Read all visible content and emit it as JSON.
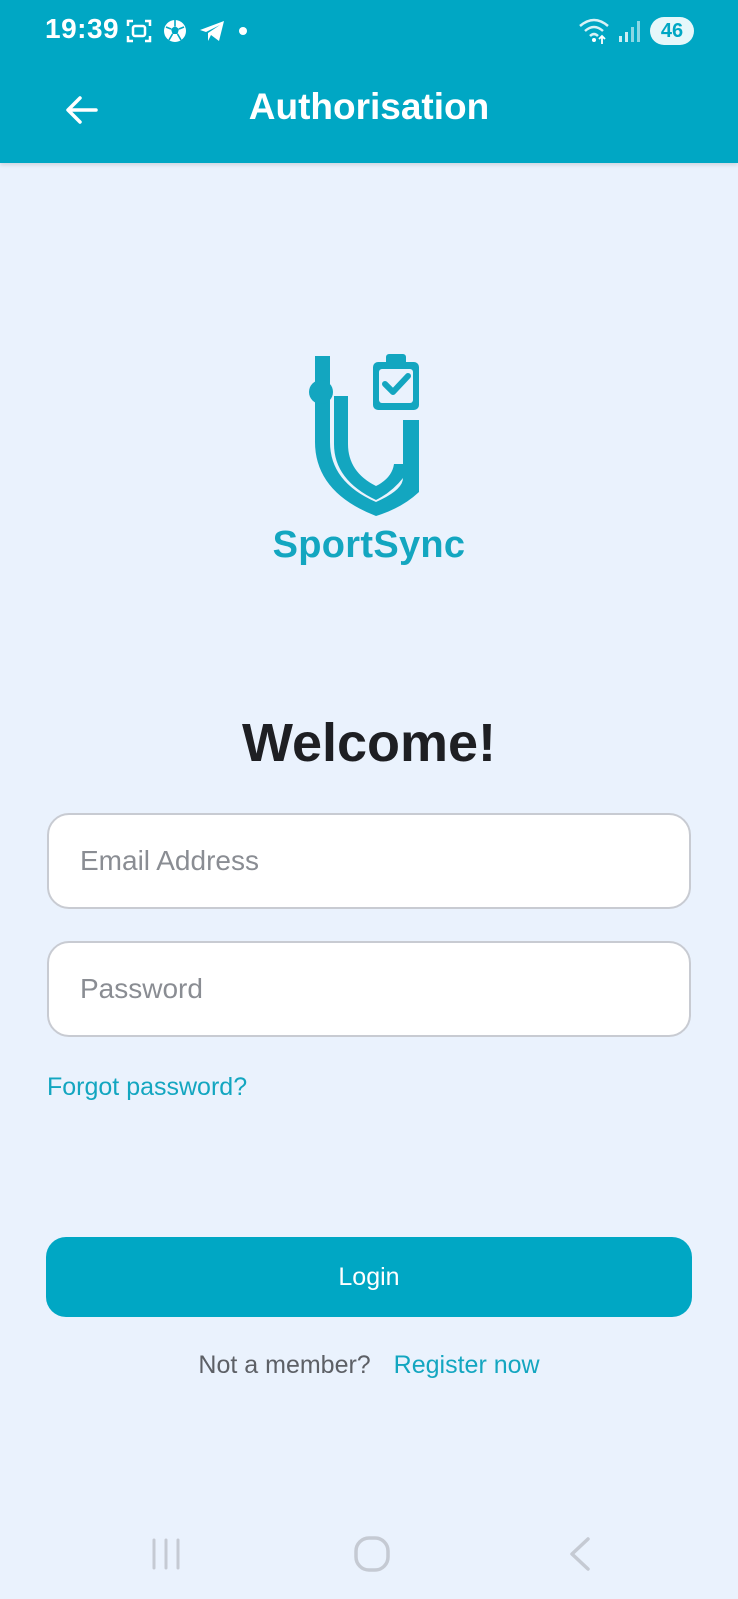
{
  "status_bar": {
    "time": "19:39",
    "battery": "46",
    "left_icons": [
      "screenshot-icon",
      "soccer-ball-icon",
      "telegram-icon",
      "dot-icon"
    ],
    "right_icons": [
      "wifi-icon",
      "signal-icon",
      "battery-icon"
    ]
  },
  "header": {
    "title": "Authorisation",
    "back_icon": "arrow-left-icon"
  },
  "logo": {
    "wordmark": "SportSync",
    "color": "#13a6c0"
  },
  "form": {
    "heading": "Welcome!",
    "email_placeholder": "Email Address",
    "email_value": "",
    "password_placeholder": "Password",
    "password_value": "",
    "forgot_link": "Forgot password?",
    "login_button": "Login",
    "not_member_text": "Not a member?",
    "register_link": "Register now"
  },
  "nav_bar": {
    "icons": [
      "recent-apps-icon",
      "home-icon",
      "back-icon"
    ]
  },
  "colors": {
    "accent": "#00a7c4",
    "background": "#eaf2fd",
    "link": "#13a6c0",
    "heading": "#1e1f23"
  }
}
